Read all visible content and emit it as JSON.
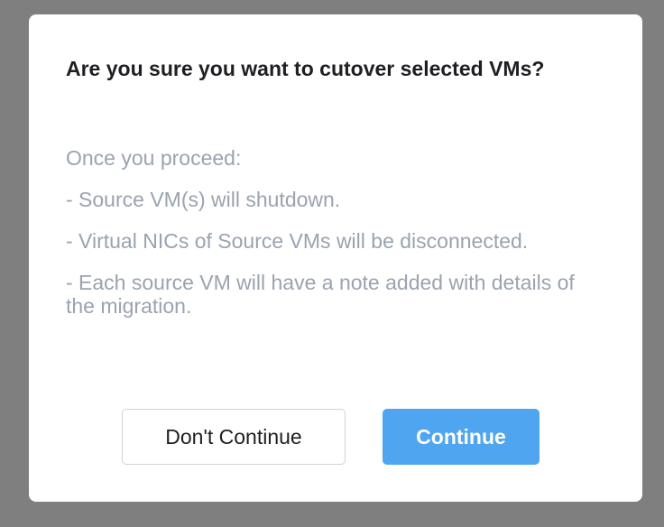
{
  "dialog": {
    "title": "Are you sure you want to cutover selected VMs?",
    "body": [
      "Once you proceed:",
      "- Source VM(s) will shutdown.",
      "- Virtual NICs of Source VMs will be disconnected.",
      "- Each source VM will have a note added with details of the migration."
    ],
    "buttons": {
      "cancel_label": "Don't Continue",
      "confirm_label": "Continue"
    }
  },
  "colors": {
    "overlay": "#7f7f80",
    "dialog_background": "#ffffff",
    "title_text": "#1d1f22",
    "body_text": "#9aa3af",
    "primary_button": "#4fa5f0",
    "secondary_border": "#cfd3d8"
  }
}
